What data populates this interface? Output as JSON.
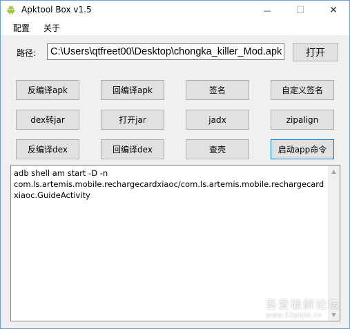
{
  "window": {
    "title": "Apktool Box v1.5",
    "minimize_glyph": "—",
    "maximize_glyph": "☐",
    "close_glyph": "✕"
  },
  "menu": {
    "items": [
      {
        "label": "配置"
      },
      {
        "label": "关于"
      }
    ]
  },
  "path": {
    "label": "路径:",
    "value": "C:\\Users\\qtfreet00\\Desktop\\chongka_killer_Mod.apk",
    "open_label": "打开"
  },
  "buttons": {
    "row1": [
      "反编译apk",
      "回编译apk",
      "签名",
      "自定义签名"
    ],
    "row2": [
      "dex转jar",
      "打开jar",
      "jadx",
      "zipalign"
    ],
    "row3": [
      "反编译dex",
      "回编译dex",
      "查壳",
      "启动app命令"
    ]
  },
  "output": {
    "text": "adb shell am start -D -n\ncom.ls.artemis.mobile.rechargecardxiaoc/com.ls.artemis.mobile.rechargecardxiaoc.GuideActivity"
  },
  "watermark": {
    "title": "吾爱破解论坛",
    "url": "www.52pojie.cn"
  },
  "colors": {
    "accent_border": "#0078d7",
    "android_green": "#a4c639"
  },
  "icons": {
    "app": "android-icon",
    "scroll_up": "scroll-up-arrow-icon",
    "scroll_down": "scroll-down-arrow-icon"
  }
}
